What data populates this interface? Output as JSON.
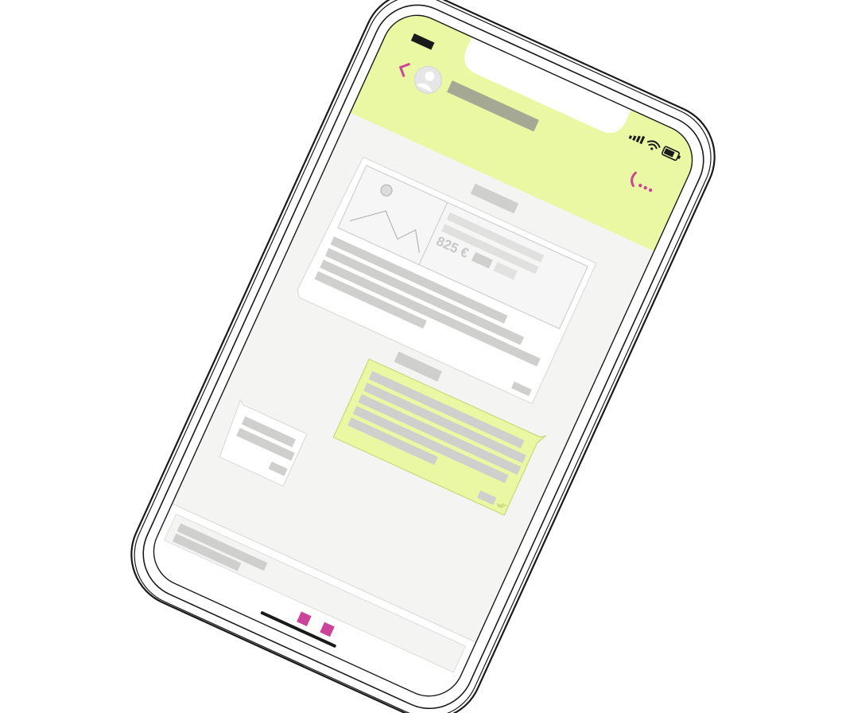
{
  "chat_header": {
    "back_icon": "chevron-left-icon",
    "avatar_icon": "user-avatar-icon",
    "status_icons": [
      "cellular-signal-icon",
      "wifi-icon",
      "battery-icon"
    ],
    "action_icons": [
      "phone-icon",
      "more-dots-icon"
    ]
  },
  "messages": {
    "shared_item": {
      "image_icon": "image-placeholder-icon",
      "price": "825 €"
    }
  },
  "composer": {
    "action_icons": [
      "attach-icon",
      "send-icon"
    ]
  },
  "colors": {
    "accent_lime": "#eaf7a3",
    "accent_magenta": "#cc4499",
    "placeholder_bar": "#cfcfcd",
    "screen_bg": "#f4f4f3",
    "outline": "#1a1a1a"
  }
}
